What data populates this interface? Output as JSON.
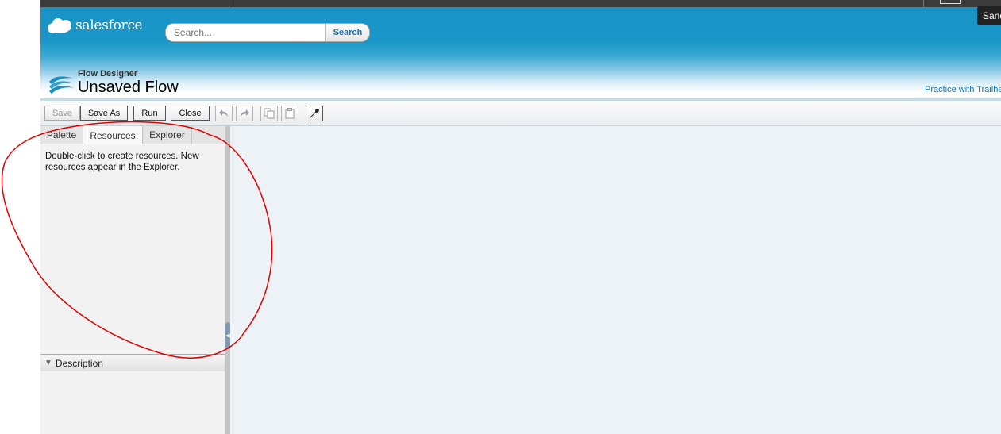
{
  "header": {
    "brand": "salesforce",
    "search_placeholder": "Search...",
    "search_button": "Search",
    "trailhead_link": "Practice with Trailhe"
  },
  "flow": {
    "subtitle": "Flow Designer",
    "title": "Unsaved Flow"
  },
  "toolbar": {
    "save": "Save",
    "save_as": "Save As",
    "run": "Run",
    "close": "Close",
    "icons": [
      "undo-icon",
      "redo-icon",
      "copy-icon",
      "paste-icon",
      "wrench-icon"
    ]
  },
  "left_panel": {
    "tabs": [
      {
        "label": "Palette",
        "active": false
      },
      {
        "label": "Resources",
        "active": true
      },
      {
        "label": "Explorer",
        "active": false
      }
    ],
    "resources_text": "Double-click to create resources. New resources appear in the Explorer.",
    "description_label": "Description"
  },
  "tooltip": {
    "text": "Sand"
  },
  "colors": {
    "header_blue": "#1793c5",
    "link_blue": "#1a73b5",
    "canvas_bg": "#ecf2f6",
    "annotation_red": "#e00000"
  }
}
